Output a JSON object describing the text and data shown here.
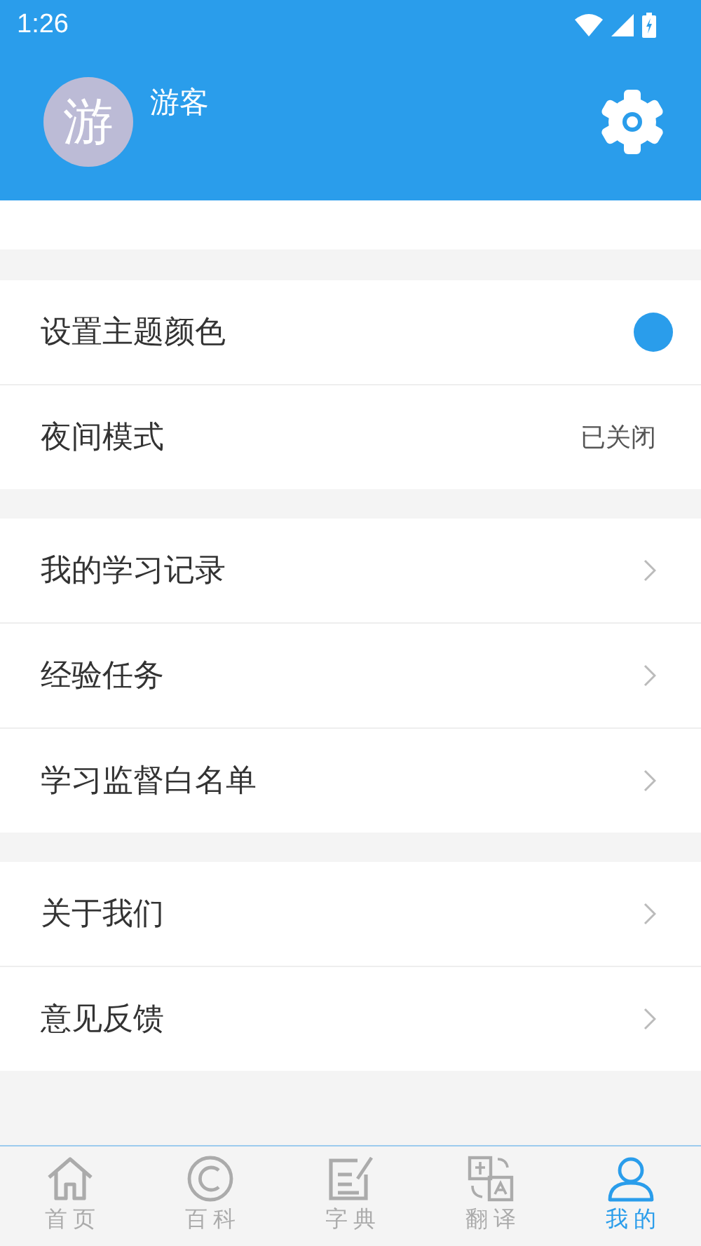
{
  "status_bar": {
    "time": "1:26"
  },
  "profile": {
    "avatar_text": "游",
    "name": "游客"
  },
  "sections": [
    {
      "items": [
        {
          "kind": "color",
          "label": "设置主题颜色",
          "color": "#2a9deb"
        },
        {
          "kind": "value",
          "label": "夜间模式",
          "value": "已关闭"
        }
      ]
    },
    {
      "items": [
        {
          "kind": "link",
          "label": "我的学习记录"
        },
        {
          "kind": "link",
          "label": "经验任务"
        },
        {
          "kind": "link",
          "label": "学习监督白名单"
        }
      ]
    },
    {
      "items": [
        {
          "kind": "link",
          "label": "关于我们"
        },
        {
          "kind": "link",
          "label": "意见反馈"
        }
      ]
    }
  ],
  "tabs": [
    {
      "kind": "home",
      "label": "首页",
      "selected": false
    },
    {
      "kind": "copyright",
      "label": "百科",
      "selected": false
    },
    {
      "kind": "edit",
      "label": "字典",
      "selected": false
    },
    {
      "kind": "translate",
      "label": "翻译",
      "selected": false
    },
    {
      "kind": "person",
      "label": "我的",
      "selected": true
    }
  ]
}
